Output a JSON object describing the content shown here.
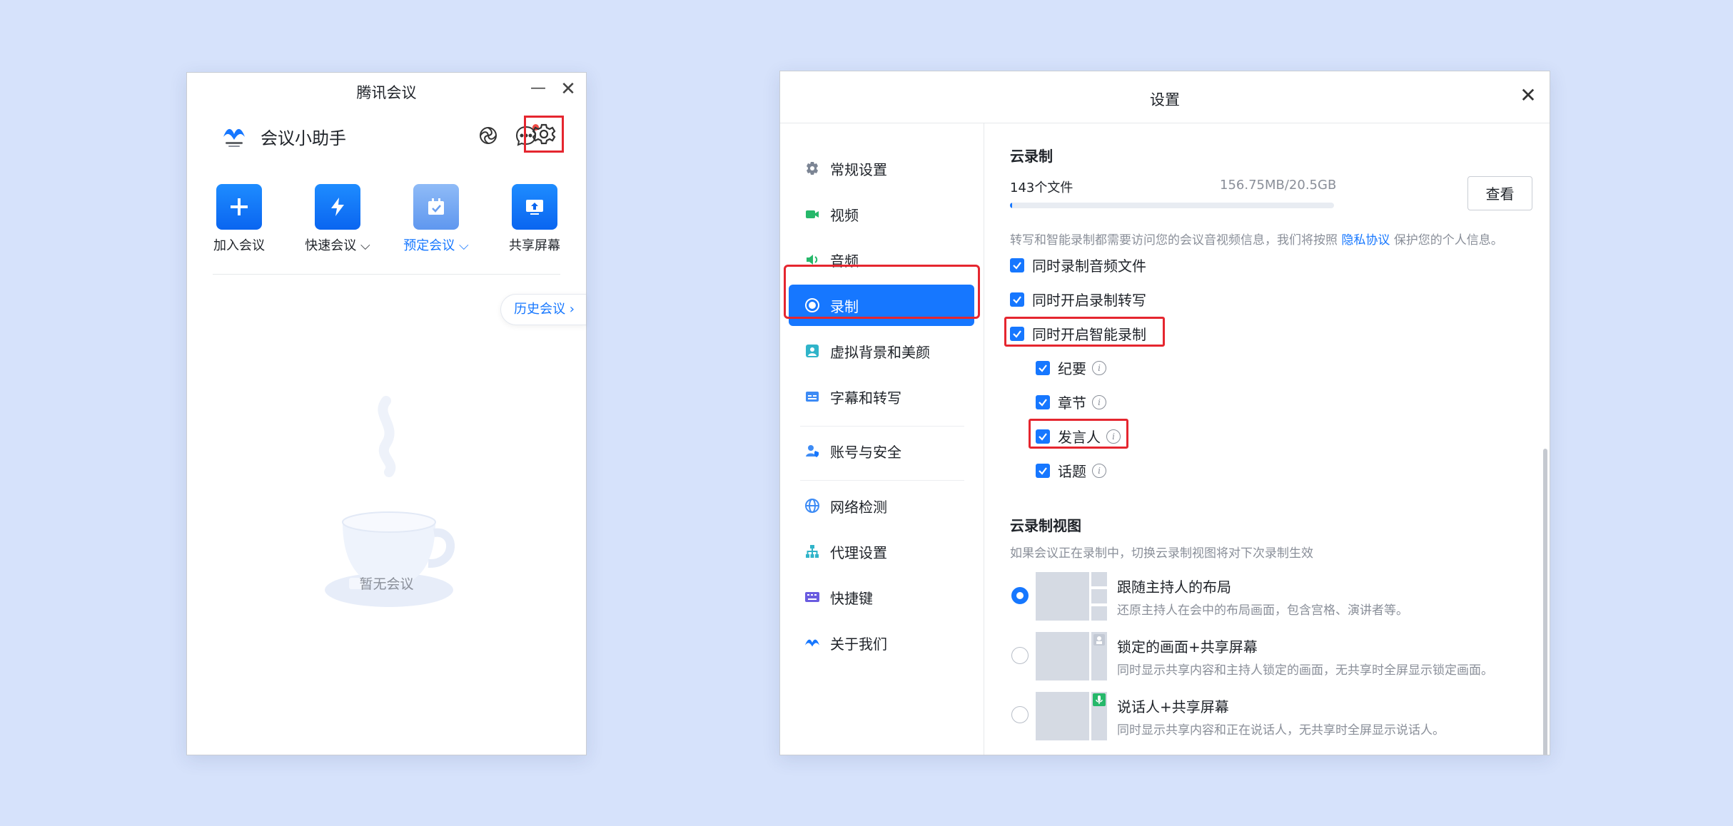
{
  "left_window": {
    "title": "腾讯会议",
    "min_glyph": "—",
    "close_glyph": "✕",
    "assistant_label": "会议小助手",
    "actions": [
      {
        "label": "加入会议",
        "icon": "plus-icon",
        "chevron": ""
      },
      {
        "label": "快速会议",
        "icon": "bolt-icon",
        "chevron": "⌵"
      },
      {
        "label": "预定会议",
        "icon": "calendar-check-icon",
        "chevron": "⌵"
      },
      {
        "label": "共享屏幕",
        "icon": "share-screen-icon",
        "chevron": ""
      }
    ],
    "history_label": "历史会议 ›",
    "empty_label": "暂无会议"
  },
  "settings_window": {
    "title": "设置",
    "close_glyph": "✕",
    "nav": [
      {
        "label": "常规设置",
        "icon": "gear-icon"
      },
      {
        "label": "视频",
        "icon": "video-icon"
      },
      {
        "label": "音频",
        "icon": "speaker-icon"
      },
      {
        "label": "录制",
        "icon": "record-icon",
        "active": true
      },
      {
        "label": "虚拟背景和美颜",
        "icon": "portrait-icon"
      },
      {
        "label": "字幕和转写",
        "icon": "caption-icon"
      },
      {
        "label": "账号与安全",
        "icon": "account-security-icon"
      },
      {
        "label": "网络检测",
        "icon": "globe-icon"
      },
      {
        "label": "代理设置",
        "icon": "network-tree-icon"
      },
      {
        "label": "快捷键",
        "icon": "keyboard-icon"
      },
      {
        "label": "关于我们",
        "icon": "brand-logo-icon"
      }
    ],
    "cloud_record": {
      "title": "云录制",
      "file_count": "143个文件",
      "storage": "156.75MB/20.5GB",
      "storage_used_fraction": 0.0075,
      "view_button": "查看",
      "notice_before": "转写和智能录制都需要访问您的会议音视频信息，我们将按照",
      "notice_link": "隐私协议",
      "notice_after": "保护您的个人信息。",
      "options": [
        {
          "label": "同时录制音频文件",
          "checked": true
        },
        {
          "label": "同时开启录制转写",
          "checked": true
        },
        {
          "label": "同时开启智能录制",
          "checked": true
        }
      ],
      "smart_options": [
        {
          "label": "纪要",
          "checked": true
        },
        {
          "label": "章节",
          "checked": true
        },
        {
          "label": "发言人",
          "checked": true
        },
        {
          "label": "话题",
          "checked": true
        }
      ],
      "info_glyph": "i"
    },
    "cloud_view": {
      "title": "云录制视图",
      "desc": "如果会议正在录制中，切换云录制视图将对下次录制生效",
      "layouts": [
        {
          "title": "跟随主持人的布局",
          "desc": "还原主持人在会中的布局画面，包含宫格、演讲者等。",
          "selected": true
        },
        {
          "title": "锁定的画面+共享屏幕",
          "desc": "同时显示共享内容和主持人锁定的画面，无共享时全屏显示锁定画面。",
          "selected": false
        },
        {
          "title": "说话人+共享屏幕",
          "desc": "同时显示共享内容和正在说话人，无共享时全屏显示说话人。",
          "selected": false
        }
      ]
    }
  },
  "colors": {
    "accent": "#1677ff",
    "highlight": "#e5262f",
    "background": "#d6e2fb"
  }
}
